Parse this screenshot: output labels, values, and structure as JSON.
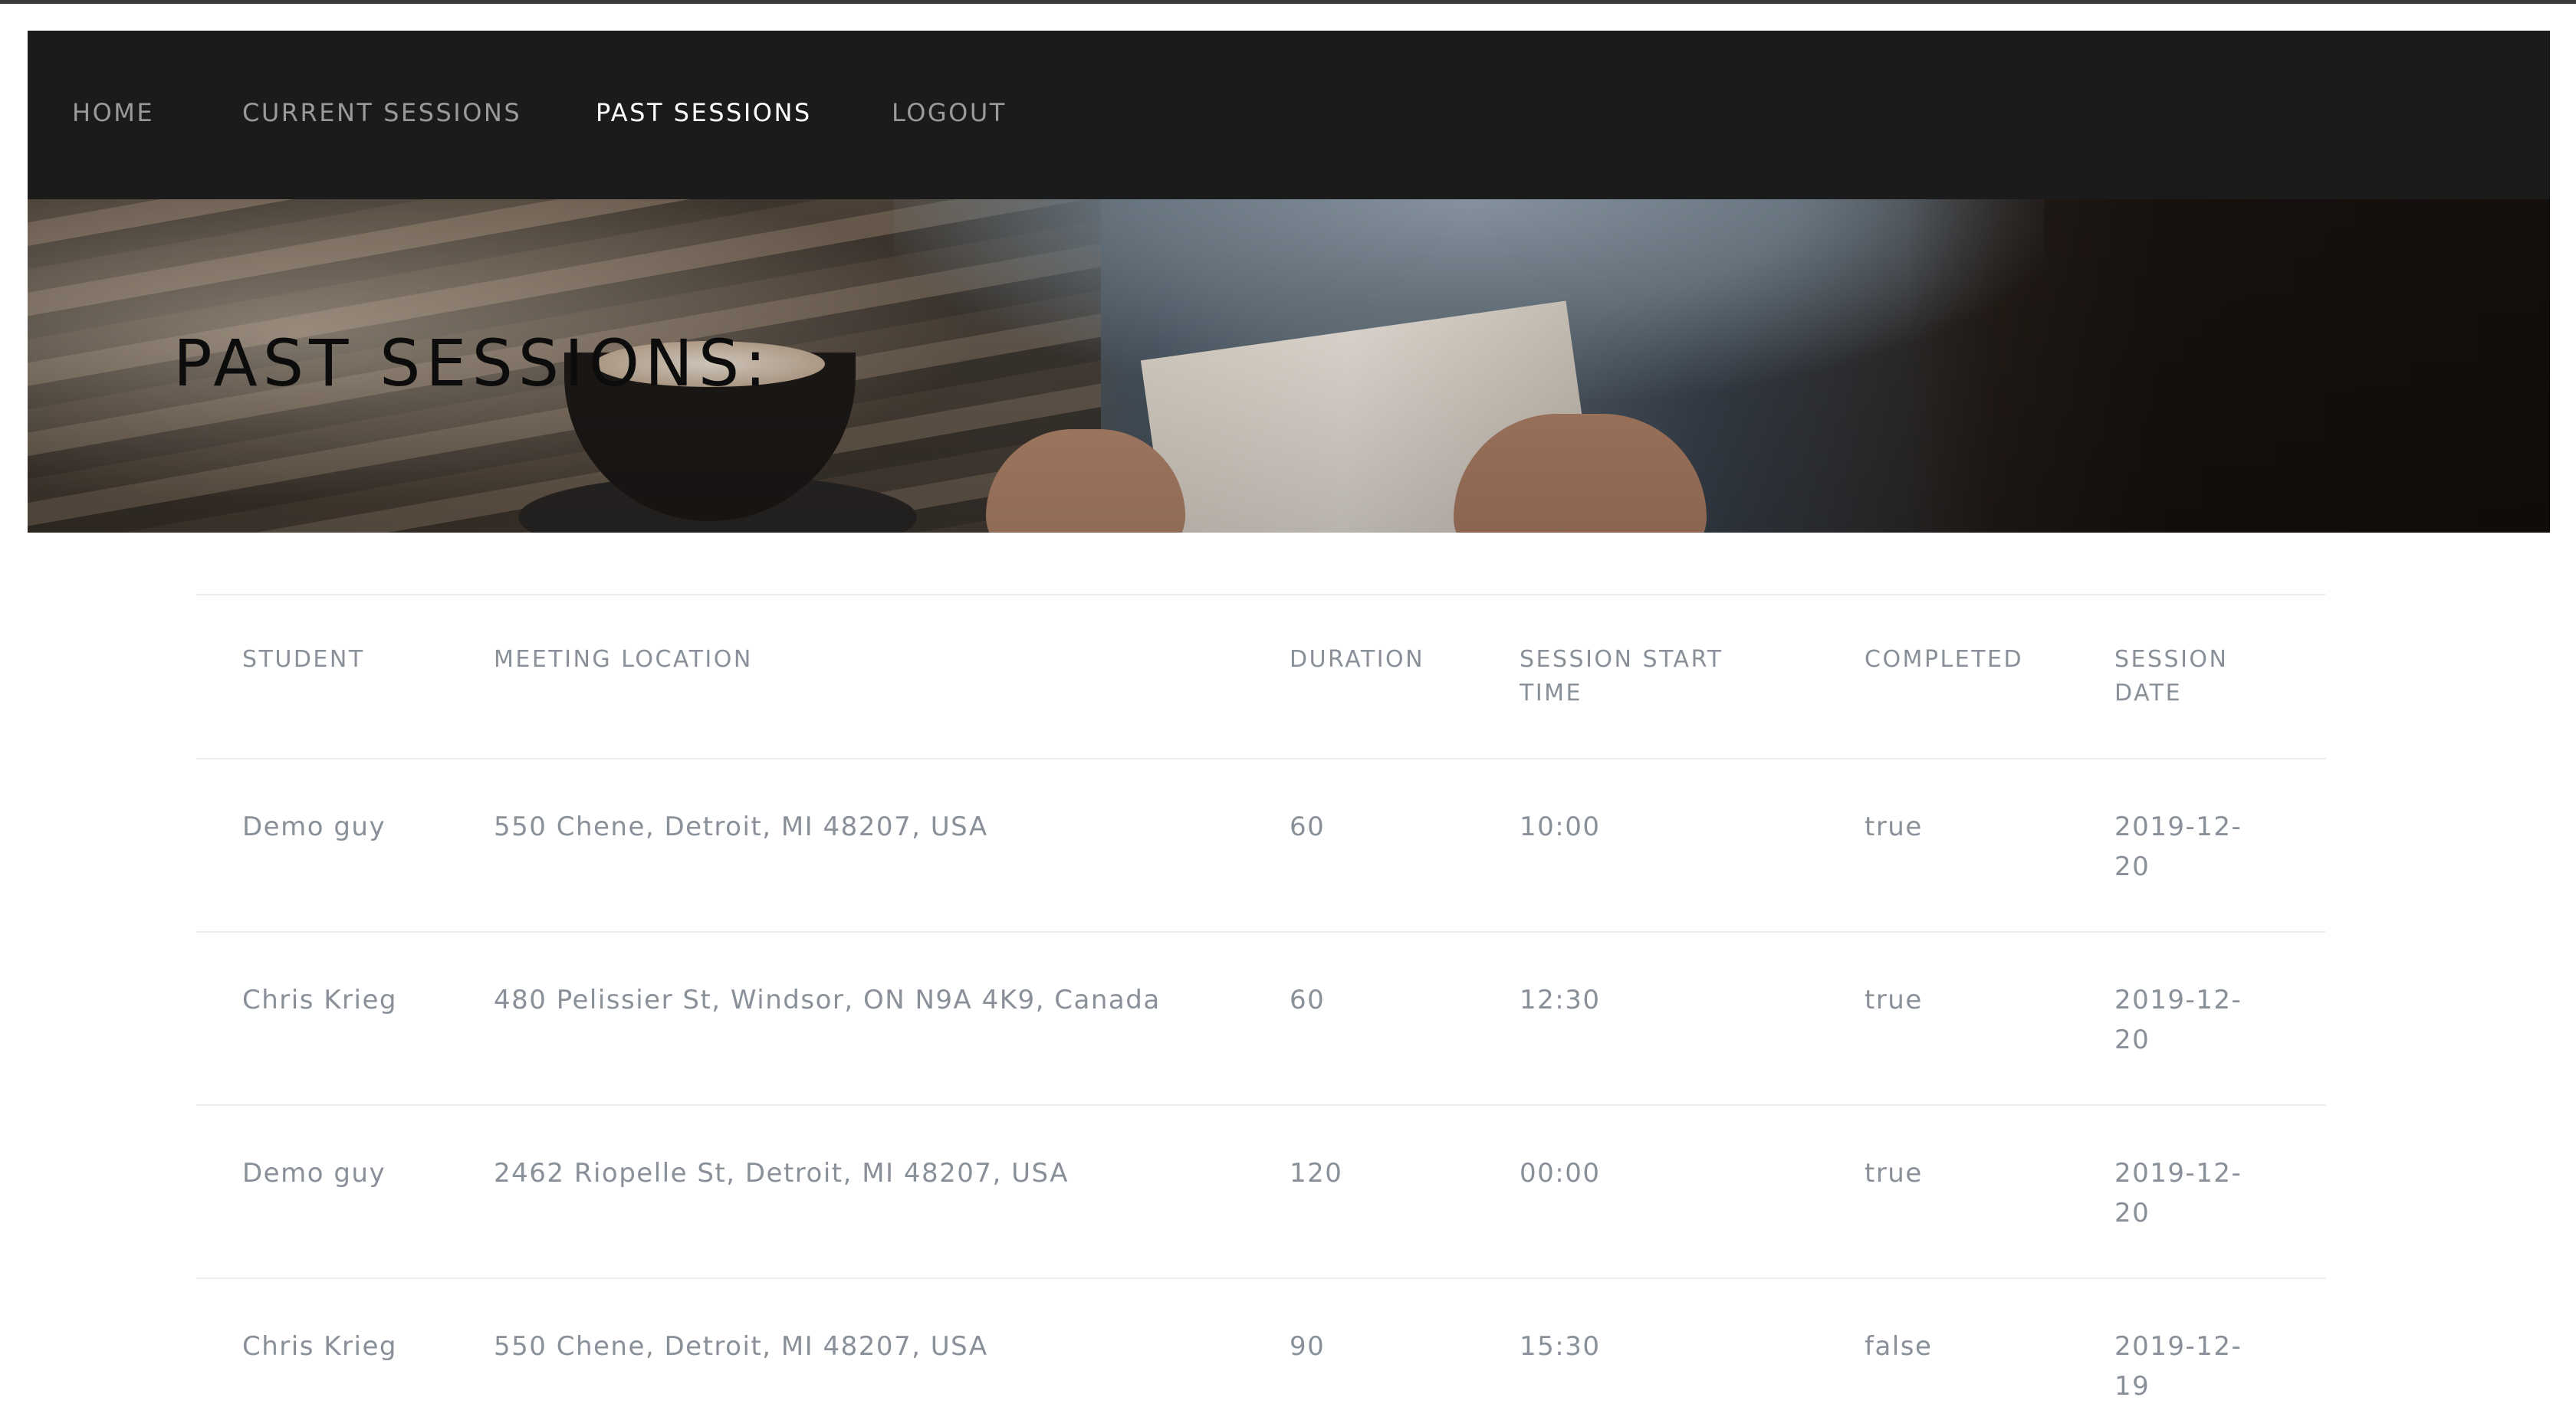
{
  "nav": {
    "items": [
      {
        "label": "HOME",
        "active": false
      },
      {
        "label": "CURRENT SESSIONS",
        "active": false
      },
      {
        "label": "PAST SESSIONS",
        "active": true
      },
      {
        "label": "LOGOUT",
        "active": false
      }
    ]
  },
  "hero": {
    "title": "PAST SESSIONS:"
  },
  "table": {
    "columns": [
      "STUDENT",
      "MEETING LOCATION",
      "DURATION",
      "SESSION START TIME",
      "COMPLETED",
      "SESSION DATE"
    ],
    "rows": [
      {
        "student": "Demo guy",
        "location": "550 Chene, Detroit, MI 48207, USA",
        "duration": "60",
        "start_time": "10:00",
        "completed": "true",
        "date": "2019-12-20"
      },
      {
        "student": "Chris Krieg",
        "location": "480 Pelissier St, Windsor, ON N9A 4K9, Canada",
        "duration": "60",
        "start_time": "12:30",
        "completed": "true",
        "date": "2019-12-20"
      },
      {
        "student": "Demo guy",
        "location": "2462 Riopelle St, Detroit, MI 48207, USA",
        "duration": "120",
        "start_time": "00:00",
        "completed": "true",
        "date": "2019-12-20"
      },
      {
        "student": "Chris Krieg",
        "location": "550 Chene, Detroit, MI 48207, USA",
        "duration": "90",
        "start_time": "15:30",
        "completed": "false",
        "date": "2019-12-19"
      }
    ]
  }
}
